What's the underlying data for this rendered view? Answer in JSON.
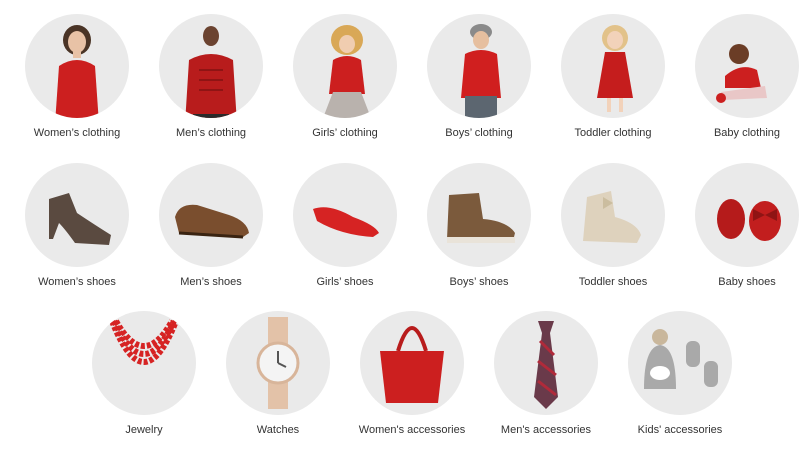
{
  "colors": {
    "circle_bg": "#eaeaea",
    "accent_red": "#cc1f1f",
    "text": "#333333"
  },
  "categories": {
    "row1": [
      {
        "label": "Women’s clothing",
        "icon": "womens-clothing-image"
      },
      {
        "label": "Men’s clothing",
        "icon": "mens-clothing-image"
      },
      {
        "label": "Girls’ clothing",
        "icon": "girls-clothing-image"
      },
      {
        "label": "Boys’ clothing",
        "icon": "boys-clothing-image"
      },
      {
        "label": "Toddler clothing",
        "icon": "toddler-clothing-image"
      },
      {
        "label": "Baby clothing",
        "icon": "baby-clothing-image"
      }
    ],
    "row2": [
      {
        "label": "Women’s shoes",
        "icon": "womens-shoes-image"
      },
      {
        "label": "Men’s shoes",
        "icon": "mens-shoes-image"
      },
      {
        "label": "Girls’ shoes",
        "icon": "girls-shoes-image"
      },
      {
        "label": "Boys’ shoes",
        "icon": "boys-shoes-image"
      },
      {
        "label": "Toddler shoes",
        "icon": "toddler-shoes-image"
      },
      {
        "label": "Baby shoes",
        "icon": "baby-shoes-image"
      }
    ],
    "row3": [
      {
        "label": "Jewelry",
        "icon": "jewelry-image"
      },
      {
        "label": "Watches",
        "icon": "watches-image"
      },
      {
        "label": "Women's accessories",
        "icon": "womens-accessories-image"
      },
      {
        "label": "Men's accessories",
        "icon": "mens-accessories-image"
      },
      {
        "label": "Kids' accessories",
        "icon": "kids-accessories-image"
      }
    ]
  }
}
